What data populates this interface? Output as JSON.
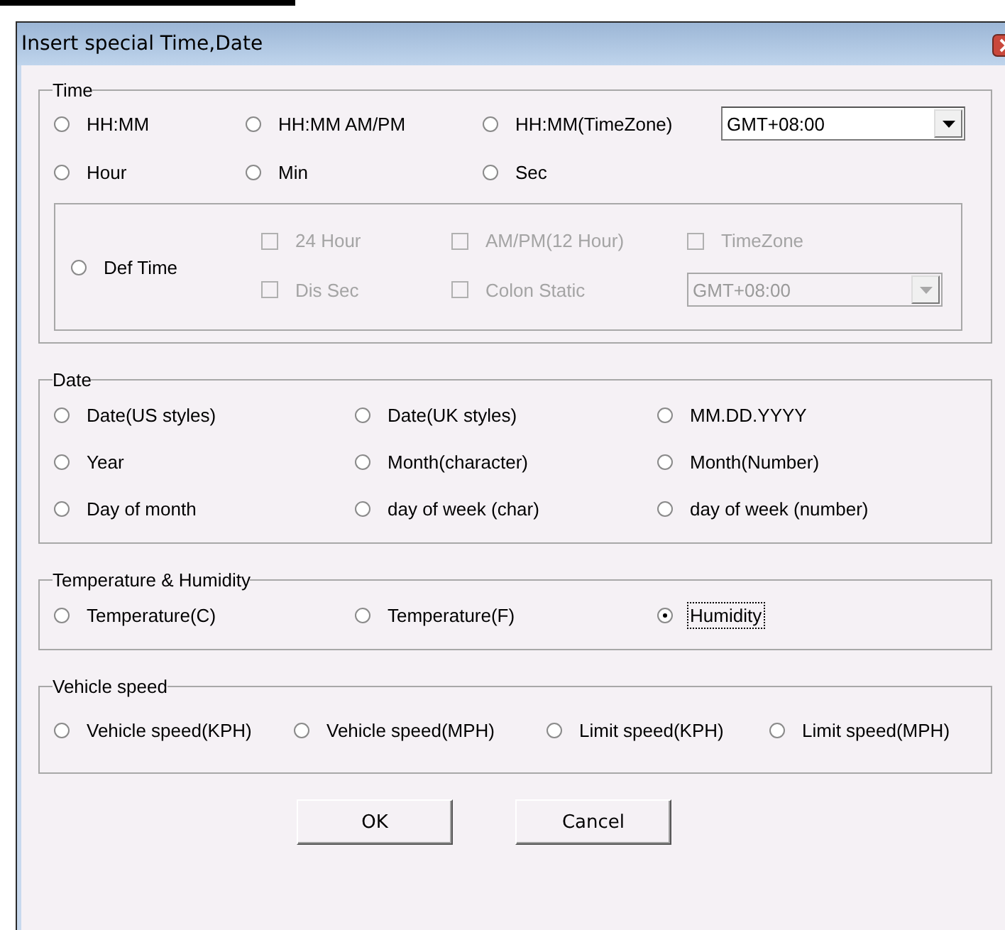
{
  "window": {
    "title": "Insert special Time,Date"
  },
  "groups": [
    {
      "kind": "time",
      "legend": "Time",
      "rows": [
        [
          {
            "label": "HH:MM",
            "selected": false
          },
          {
            "label": "HH:MM AM/PM",
            "selected": false
          },
          {
            "label": "HH:MM(TimeZone)",
            "selected": false
          }
        ],
        [
          {
            "label": "Hour",
            "selected": false
          },
          {
            "label": "Min",
            "selected": false
          },
          {
            "label": "Sec",
            "selected": false
          }
        ]
      ],
      "timezone": {
        "value": "GMT+08:00",
        "disabled": false
      },
      "def_time": {
        "option": {
          "label": "Def Time",
          "selected": false
        },
        "checkboxes": [
          [
            {
              "label": "24 Hour",
              "checked": false,
              "disabled": true
            },
            {
              "label": "AM/PM(12 Hour)",
              "checked": false,
              "disabled": true
            },
            {
              "label": "TimeZone",
              "checked": false,
              "disabled": true
            }
          ],
          [
            {
              "label": "Dis Sec",
              "checked": false,
              "disabled": true
            },
            {
              "label": "Colon Static",
              "checked": false,
              "disabled": true
            }
          ]
        ],
        "timezone": {
          "value": "GMT+08:00",
          "disabled": true
        }
      }
    },
    {
      "kind": "options",
      "legend": "Date",
      "rows": [
        [
          {
            "label": "Date(US styles)",
            "selected": false
          },
          {
            "label": "Date(UK styles)",
            "selected": false
          },
          {
            "label": "MM.DD.YYYY",
            "selected": false
          }
        ],
        [
          {
            "label": "Year",
            "selected": false
          },
          {
            "label": "Month(character)",
            "selected": false
          },
          {
            "label": "Month(Number)",
            "selected": false
          }
        ],
        [
          {
            "label": "Day of month",
            "selected": false
          },
          {
            "label": "day of week (char)",
            "selected": false
          },
          {
            "label": "day of week (number)",
            "selected": false
          }
        ]
      ]
    },
    {
      "kind": "options",
      "legend": "Temperature & Humidity",
      "rows": [
        [
          {
            "label": "Temperature(C)",
            "selected": false,
            "focused": false
          },
          {
            "label": "Temperature(F)",
            "selected": false,
            "focused": false
          },
          {
            "label": "Humidity",
            "selected": true,
            "focused": true
          }
        ]
      ]
    },
    {
      "kind": "options",
      "legend": "Vehicle speed",
      "rows": [
        [
          {
            "label": "Vehicle speed(KPH)",
            "selected": false
          },
          {
            "label": "Vehicle speed(MPH)",
            "selected": false
          },
          {
            "label": "Limit speed(KPH)",
            "selected": false
          },
          {
            "label": "Limit speed(MPH)",
            "selected": false
          }
        ]
      ]
    }
  ],
  "buttons": [
    {
      "label": "OK"
    },
    {
      "label": "Cancel"
    }
  ]
}
